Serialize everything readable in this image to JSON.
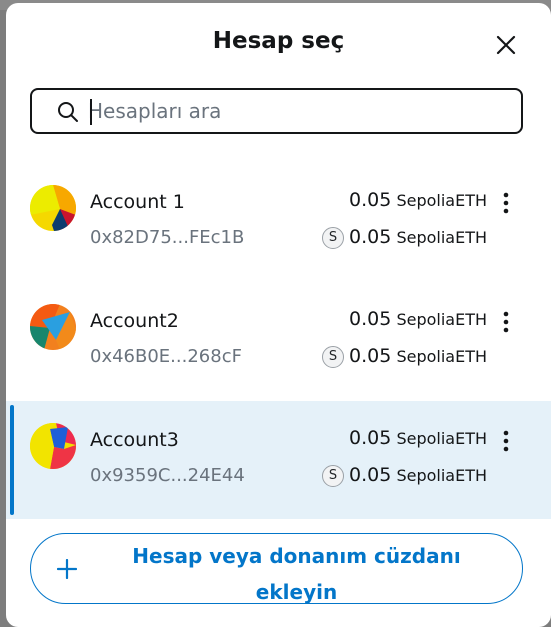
{
  "modal": {
    "title": "Hesap seç"
  },
  "search": {
    "placeholder": "Hesapları ara"
  },
  "accounts": [
    {
      "name": "Account 1",
      "address": "0x82D75...FEc1B",
      "balance_amount": "0.05",
      "balance_unit": "SepoliaETH",
      "network_badge": "S",
      "token_amount": "0.05",
      "token_unit": "SepoliaETH",
      "selected": false
    },
    {
      "name": "Account2",
      "address": "0x46B0E...268cF",
      "balance_amount": "0.05",
      "balance_unit": "SepoliaETH",
      "network_badge": "S",
      "token_amount": "0.05",
      "token_unit": "SepoliaETH",
      "selected": false
    },
    {
      "name": "Account3",
      "address": "0x9359C...24E44",
      "balance_amount": "0.05",
      "balance_unit": "SepoliaETH",
      "network_badge": "S",
      "token_amount": "0.05",
      "token_unit": "SepoliaETH",
      "selected": true
    }
  ],
  "footer": {
    "add_label_line1": "Hesap veya donanım cüzdanı",
    "add_label_line2": "ekleyin"
  },
  "colors": {
    "accent": "#0376c9",
    "selected_bg": "#e5f1f9",
    "text_primary": "#141618",
    "text_muted": "#6a737d"
  },
  "icons": {
    "close": "close-icon",
    "search": "search-icon",
    "menu": "kebab-menu-icon",
    "add": "plus-icon"
  }
}
